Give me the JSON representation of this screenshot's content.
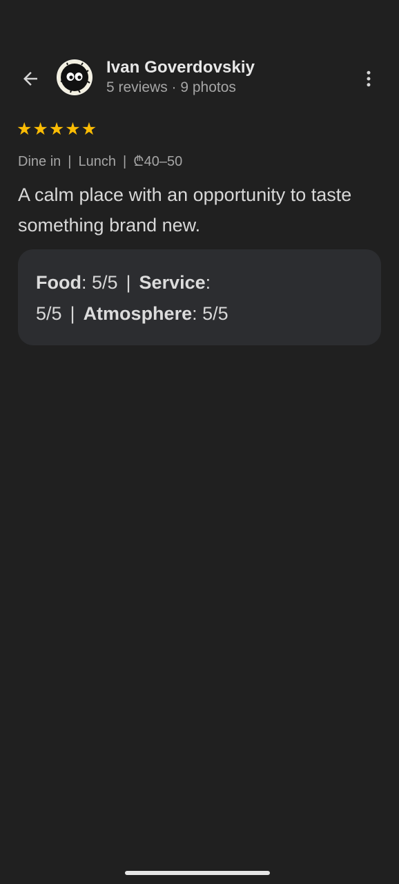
{
  "reviewer": {
    "name": "Ivan Goverdovskiy",
    "meta": "5 reviews · 9 photos"
  },
  "icons": {
    "back": "arrow-back-icon",
    "more": "more-vert-icon",
    "star": "star-icon"
  },
  "rating": {
    "stars": 5,
    "star_glyph": "★",
    "star_color": "#fbbc04"
  },
  "visit": {
    "dine": "Dine in",
    "meal": "Lunch",
    "price": "₾40–50",
    "separator": "|"
  },
  "review": {
    "text": "A calm place with an opportunity to taste something brand new."
  },
  "ratings": {
    "food_label": "Food",
    "food_value": ": 5/5",
    "service_label": "Service",
    "service_sep": ":",
    "service_value": "5/5",
    "atmosphere_label": "Atmosphere",
    "atmosphere_value": ": 5/5",
    "separator": "|"
  },
  "colors": {
    "background": "#202020",
    "card": "#2c2d30",
    "accent_star": "#fbbc04"
  }
}
